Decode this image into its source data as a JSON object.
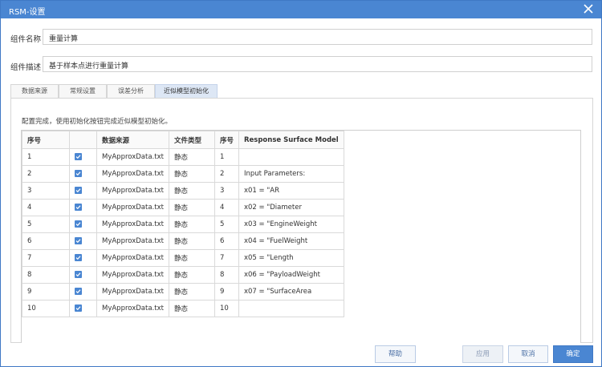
{
  "window": {
    "title": "RSM-设置"
  },
  "form": {
    "name_label": "组件名称",
    "name_value": "重量计算",
    "desc_label": "组件描述",
    "desc_value": "基于样本点进行重量计算"
  },
  "tabs": [
    {
      "label": "数据来源",
      "active": false
    },
    {
      "label": "常规设置",
      "active": false
    },
    {
      "label": "误差分析",
      "active": false
    },
    {
      "label": "近似模型初始化",
      "active": true
    }
  ],
  "panel": {
    "hint": "配置完成，使用初始化按钮完成近似模型初始化。",
    "table": {
      "headers": [
        "序号",
        "",
        "数据来源",
        "文件类型",
        "序号",
        "Response Surface Model"
      ],
      "rows": [
        {
          "idx": "1",
          "checked": true,
          "source": "MyApproxData.txt",
          "type": "静态",
          "idx2": "1",
          "rsm": ""
        },
        {
          "idx": "2",
          "checked": true,
          "source": "MyApproxData.txt",
          "type": "静态",
          "idx2": "2",
          "rsm": "Input Parameters:"
        },
        {
          "idx": "3",
          "checked": true,
          "source": "MyApproxData.txt",
          "type": "静态",
          "idx2": "3",
          "rsm": "x01 = \"AR"
        },
        {
          "idx": "4",
          "checked": true,
          "source": "MyApproxData.txt",
          "type": "静态",
          "idx2": "4",
          "rsm": "x02 = \"Diameter"
        },
        {
          "idx": "5",
          "checked": true,
          "source": "MyApproxData.txt",
          "type": "静态",
          "idx2": "5",
          "rsm": "x03 = \"EngineWeight"
        },
        {
          "idx": "6",
          "checked": true,
          "source": "MyApproxData.txt",
          "type": "静态",
          "idx2": "6",
          "rsm": "x04 = \"FuelWeight"
        },
        {
          "idx": "7",
          "checked": true,
          "source": "MyApproxData.txt",
          "type": "静态",
          "idx2": "7",
          "rsm": "x05 = \"Length"
        },
        {
          "idx": "8",
          "checked": true,
          "source": "MyApproxData.txt",
          "type": "静态",
          "idx2": "8",
          "rsm": "x06 = \"PayloadWeight"
        },
        {
          "idx": "9",
          "checked": true,
          "source": "MyApproxData.txt",
          "type": "静态",
          "idx2": "9",
          "rsm": "x07 = \"SurfaceArea"
        },
        {
          "idx": "10",
          "checked": true,
          "source": "MyApproxData.txt",
          "type": "静态",
          "idx2": "10",
          "rsm": ""
        }
      ]
    }
  },
  "buttons": {
    "help": "帮助",
    "apply": "应用",
    "cancel": "取消",
    "ok": "确定"
  },
  "icons": {
    "close": "close-icon",
    "checkbox": "checkbox-checked-icon"
  },
  "colors": {
    "accent": "#4a86d2"
  }
}
